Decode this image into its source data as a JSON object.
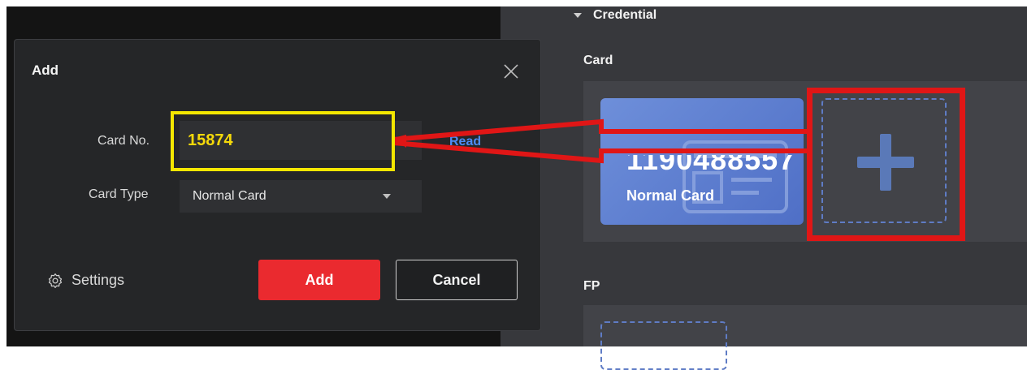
{
  "credential_panel": {
    "section_title": "Credential",
    "card_label": "Card",
    "fp_label": "FP",
    "card_tile": {
      "number": "1190488557",
      "type": "Normal Card"
    }
  },
  "dialog": {
    "title": "Add",
    "card_no_label": "Card No.",
    "card_no_value": "15874",
    "read_label": "Read",
    "card_type_label": "Card Type",
    "card_type_value": "Normal Card",
    "settings_label": "Settings",
    "add_label": "Add",
    "cancel_label": "Cancel"
  },
  "colors": {
    "primary": "#ea2a2f",
    "highlight_yellow": "#f3e600",
    "highlight_red": "#e01616",
    "card_blue": "#5b7bd0",
    "link_blue": "#4c8cf5"
  },
  "icons": [
    "close-icon",
    "chevron-down-icon",
    "gear-icon",
    "plus-icon",
    "id-card-icon"
  ]
}
